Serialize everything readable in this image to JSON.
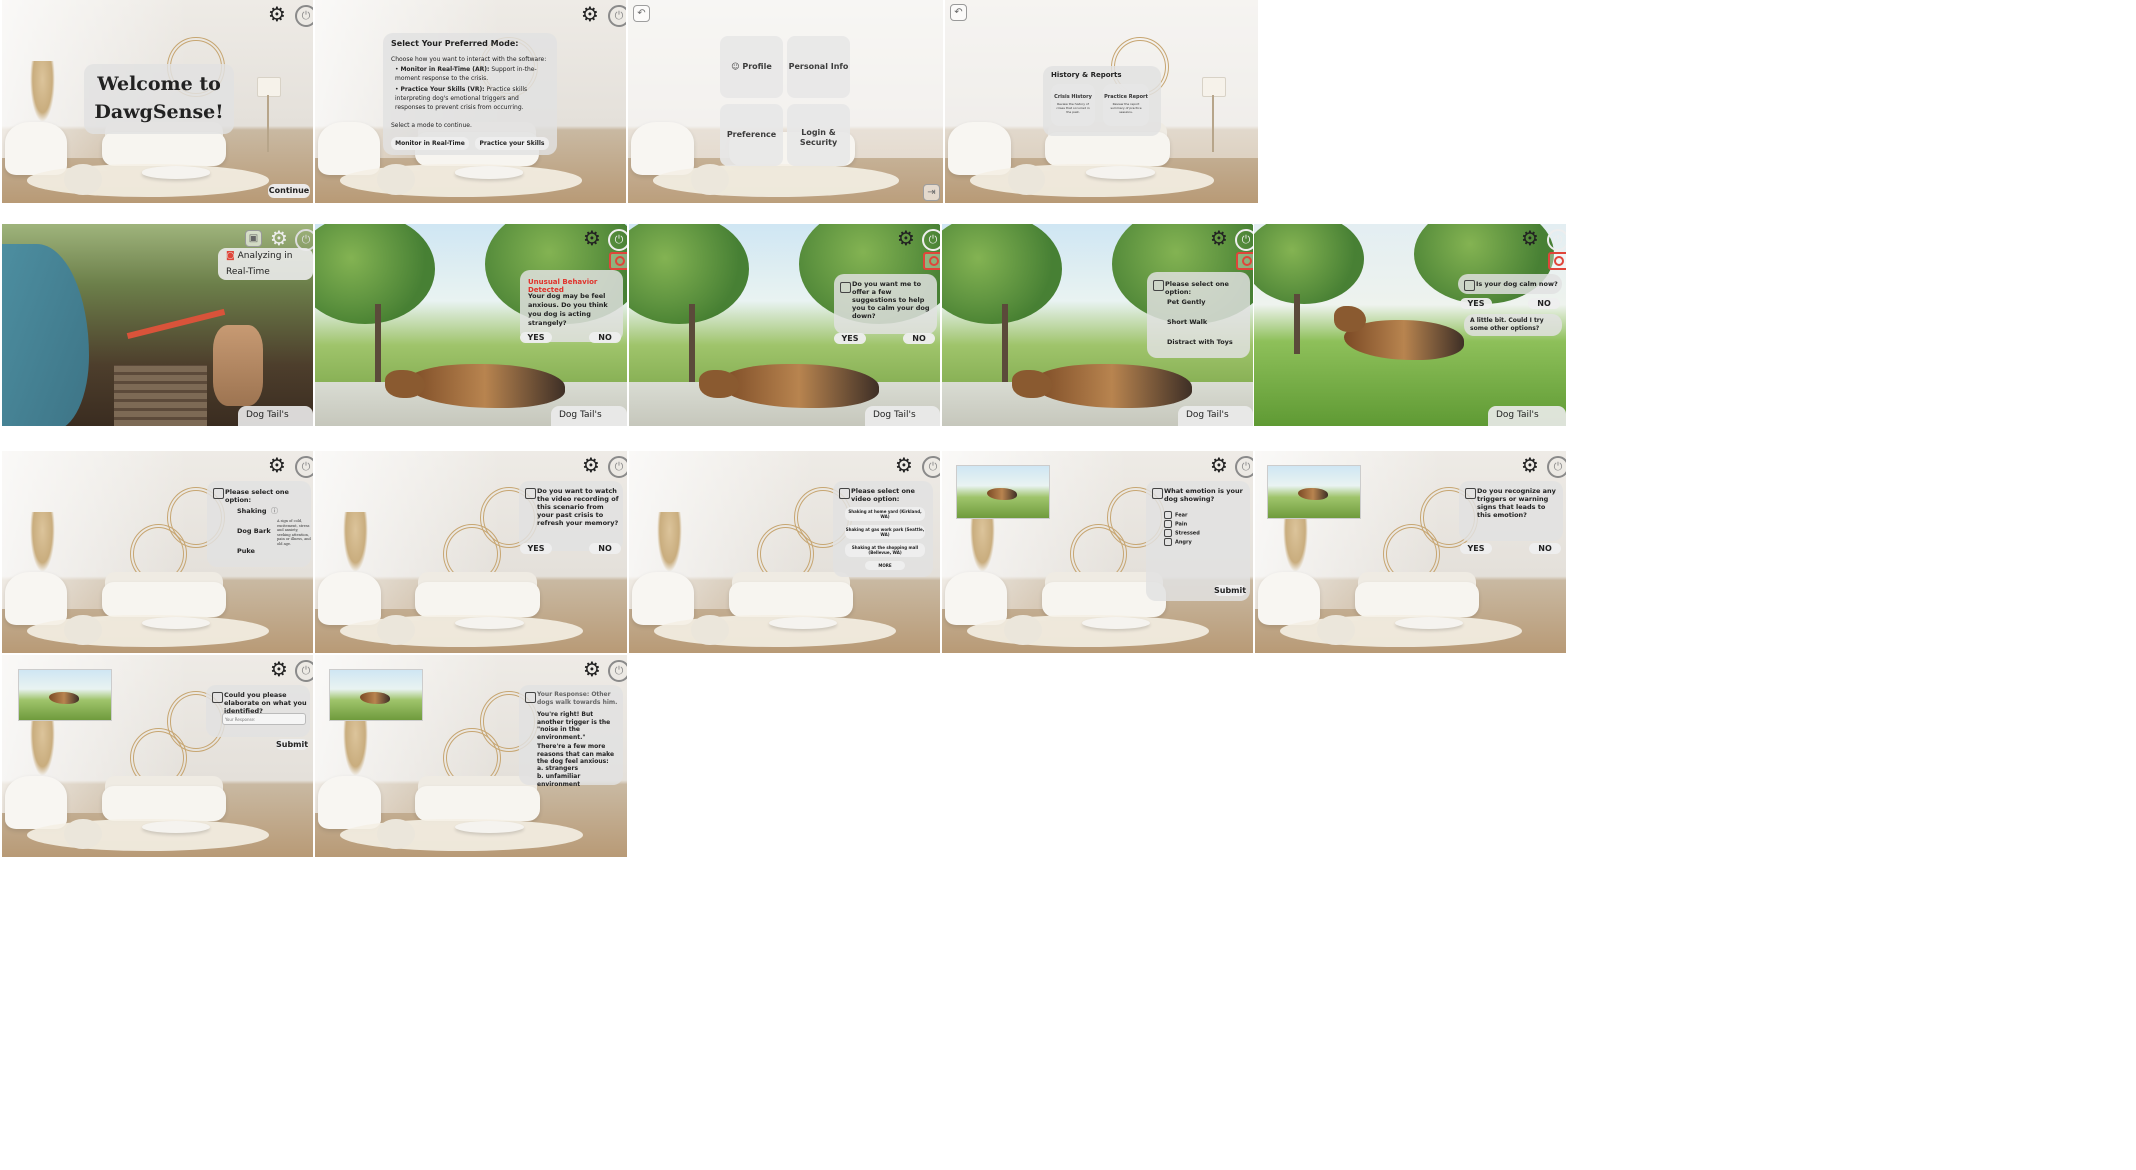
{
  "common": {
    "settings_icon": "gear-icon",
    "power_icon": "power-icon",
    "back_icon": "back-icon",
    "camera_icon": "camera-icon",
    "status_label": "Dog Tail's Status",
    "status_colors": {
      "green": "#3cb44b",
      "red": "#e53935",
      "yellow": "#f2d545"
    },
    "yes": "YES",
    "no": "NO",
    "submit": "Submit"
  },
  "s1": {
    "title": "Welcome to DawgSense!",
    "continue": "Continue"
  },
  "s2": {
    "title": "Select Your Preferred Mode:",
    "intro": "Choose how you want to interact with the software:",
    "bullet1_bold": "Monitor in Real-Time (AR):",
    "bullet1_text": "Support in-the-moment response to the crisis.",
    "bullet2_bold": "Practice Your Skills (VR):",
    "bullet2_text": "Practice skills interpreting dog's emotional triggers and responses to prevent crisis from occurring.",
    "select_prompt": "Select a mode to continue.",
    "btn_monitor": "Monitor in Real-Time",
    "btn_practice": "Practice your Skills"
  },
  "s3": {
    "profile": "Profile",
    "personal_info": "Personal Info",
    "preference": "Preference",
    "login_security": "Login & Security"
  },
  "s4": {
    "title": "History & Reports",
    "crisis_history": "Crisis History",
    "crisis_history_desc": "Review the history of crises that occurred in the past.",
    "practice_report": "Practice Report",
    "practice_report_desc": "Review the report summary of practice sessions."
  },
  "s5": {
    "analyzing": "Analyzing in Real-Time"
  },
  "s6": {
    "heading": "Unusual Behavior Detected",
    "text": "Your dog may be feel anxious. Do you think you dog is acting strangely?"
  },
  "s7": {
    "question": "Do you want me to offer a few suggestions to help you to calm your dog down?"
  },
  "s8": {
    "question": "Please select one option:",
    "options": [
      "Pet Gently",
      "Short Walk",
      "Distract with Toys"
    ]
  },
  "s9": {
    "question": "Is your dog calm now?",
    "answer": "A little bit. Could I try some other options?"
  },
  "s10": {
    "question": "Please select one option:",
    "options": [
      "Shaking",
      "Dog Bark",
      "Puke"
    ],
    "info_text": "A sign of cold, excitement, stress and anxiety, seeking attention, pain or illness, and old age."
  },
  "s11": {
    "question": "Do you want to watch the video recording of this scenario from your past crisis to refresh your memory?"
  },
  "s12": {
    "question": "Please select one video option:",
    "options": [
      "Shaking at home yard (Kirkland, WA)",
      "Shaking at gas work park (Seattle, WA)",
      "Shaking at the shopping mall (Bellevue, WA)"
    ],
    "more": "MORE"
  },
  "s13": {
    "question": "What emotion is your dog showing?",
    "options": [
      "Fear",
      "Pain",
      "Stressed",
      "Angry"
    ]
  },
  "s14": {
    "question": "Do you recognize any triggers or warning signs that leads to this emotion?"
  },
  "s15": {
    "question": "Could you please elaborate on what you identified?",
    "placeholder": "Your Response:"
  },
  "s16": {
    "response": "Your Response: Other dogs walk towards him.",
    "reply": "You're right! But another trigger is the \"noise in the environment.\"",
    "more_intro": "There're a few more reasons that can make the dog feel anxious:",
    "reasons": [
      "a. strangers",
      "b. unfamiliar environment"
    ]
  }
}
